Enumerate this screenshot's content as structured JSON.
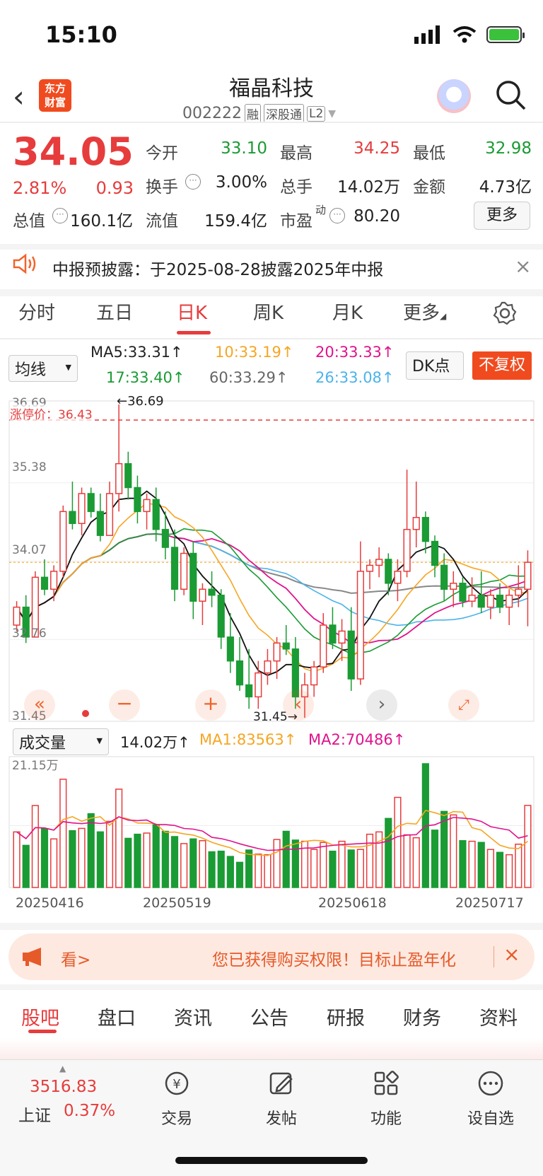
{
  "status": {
    "time": "15:10"
  },
  "header": {
    "back": "‹",
    "logo_line1": "东方",
    "logo_line2": "财富",
    "title": "福晶科技",
    "code": "002222",
    "tags": [
      "融",
      "深股通",
      "L2"
    ]
  },
  "quote": {
    "price": "34.05",
    "change_pct": "2.81%",
    "change_amt": "0.93",
    "open_label": "今开",
    "open": "33.10",
    "high_label": "最高",
    "high": "34.25",
    "low_label": "最低",
    "low": "32.98",
    "turnover_label": "换手",
    "turnover": "3.00%",
    "volume_label": "总手",
    "volume": "14.02万",
    "amount_label": "金额",
    "amount": "4.73亿",
    "mktcap_label": "总值",
    "mktcap": "160.1亿",
    "float_label": "流值",
    "float": "159.4亿",
    "pe_label": "市盈",
    "pe_sup": "动",
    "pe": "80.20",
    "more": "更多"
  },
  "notice": {
    "text": "中报预披露：于2025-08-28披露2025年中报",
    "close": "×"
  },
  "tabs": [
    "分时",
    "五日",
    "日K",
    "周K",
    "月K",
    "更多",
    ""
  ],
  "ma_legend": {
    "select": "均线",
    "ma5": "MA5:33.31↑",
    "ma10": "10:33.19↑",
    "ma20": "20:33.33↑",
    "ma17": "17:33.40↑",
    "ma60": "60:33.29↑",
    "ma26": "26:33.08↑",
    "dk": "DK点",
    "fq": "不复权"
  },
  "chart_labels": {
    "y_top": "36.69",
    "y_2": "35.38",
    "y_3": "34.07",
    "y_4": "32.76",
    "y_bot": "31.45",
    "limit_up": "涨停价：36.43",
    "max_mark": "←36.69",
    "min_mark": "31.45→",
    "vol_select": "成交量",
    "vol_value": "14.02万↑",
    "ma1": "MA1:83563↑",
    "ma2": "MA2:70486↑",
    "vol_max": "21.15万",
    "dates": [
      "20250416",
      "20250519",
      "20250618",
      "20250717"
    ]
  },
  "chart_data": {
    "type": "candlestick",
    "ylim": [
      31.45,
      36.69
    ],
    "limit_up": 36.43,
    "colors": {
      "up": "#e63c3c",
      "down": "#1a9b34"
    },
    "candles": [
      [
        33.0,
        33.4,
        32.9,
        33.3
      ],
      [
        33.3,
        33.5,
        32.7,
        32.8
      ],
      [
        32.8,
        33.9,
        32.8,
        33.8
      ],
      [
        33.8,
        34.1,
        33.5,
        33.6
      ],
      [
        33.6,
        34.0,
        33.4,
        33.9
      ],
      [
        33.9,
        35.0,
        33.8,
        34.9
      ],
      [
        34.9,
        35.4,
        34.6,
        34.7
      ],
      [
        34.7,
        35.3,
        34.5,
        35.2
      ],
      [
        35.2,
        35.3,
        34.8,
        34.9
      ],
      [
        34.9,
        35.2,
        34.4,
        34.5
      ],
      [
        34.5,
        35.4,
        34.5,
        35.2
      ],
      [
        35.2,
        36.69,
        34.9,
        35.7
      ],
      [
        35.7,
        35.9,
        35.1,
        35.3
      ],
      [
        35.3,
        35.5,
        34.7,
        34.9
      ],
      [
        34.9,
        35.2,
        34.6,
        35.1
      ],
      [
        35.1,
        35.3,
        34.4,
        34.6
      ],
      [
        34.6,
        34.9,
        34.1,
        34.3
      ],
      [
        34.3,
        34.6,
        33.4,
        33.6
      ],
      [
        33.6,
        34.3,
        33.5,
        34.2
      ],
      [
        34.2,
        34.4,
        33.1,
        33.4
      ],
      [
        33.4,
        33.7,
        33.0,
        33.6
      ],
      [
        33.6,
        33.9,
        33.3,
        33.5
      ],
      [
        33.5,
        33.6,
        32.6,
        32.8
      ],
      [
        32.8,
        33.2,
        32.2,
        32.4
      ],
      [
        32.4,
        32.8,
        31.9,
        32.0
      ],
      [
        32.0,
        32.6,
        31.6,
        31.8
      ],
      [
        31.8,
        32.4,
        31.6,
        32.2
      ],
      [
        32.2,
        32.6,
        32.0,
        32.4
      ],
      [
        32.4,
        32.8,
        32.1,
        32.7
      ],
      [
        32.7,
        33.0,
        32.5,
        32.6
      ],
      [
        32.6,
        32.8,
        31.6,
        31.8
      ],
      [
        31.8,
        32.2,
        31.45,
        32.0
      ],
      [
        32.0,
        32.4,
        31.8,
        32.3
      ],
      [
        32.3,
        33.2,
        32.2,
        33.0
      ],
      [
        33.0,
        33.3,
        32.6,
        32.7
      ],
      [
        32.7,
        33.1,
        32.4,
        32.9
      ],
      [
        32.9,
        33.3,
        31.9,
        32.1
      ],
      [
        32.1,
        34.4,
        32.0,
        33.9
      ],
      [
        33.9,
        34.1,
        33.6,
        34.0
      ],
      [
        34.0,
        34.3,
        33.8,
        34.1
      ],
      [
        34.1,
        34.2,
        33.5,
        33.7
      ],
      [
        33.7,
        34.1,
        33.4,
        33.9
      ],
      [
        33.9,
        35.6,
        33.8,
        34.6
      ],
      [
        34.6,
        35.4,
        34.3,
        34.8
      ],
      [
        34.8,
        34.9,
        34.2,
        34.4
      ],
      [
        34.4,
        34.5,
        33.8,
        34.0
      ],
      [
        34.0,
        34.2,
        33.4,
        33.6
      ],
      [
        33.6,
        33.9,
        33.3,
        33.7
      ],
      [
        33.7,
        33.8,
        33.3,
        33.4
      ],
      [
        33.4,
        33.8,
        33.3,
        33.5
      ],
      [
        33.5,
        33.9,
        33.2,
        33.3
      ],
      [
        33.3,
        33.6,
        33.1,
        33.5
      ],
      [
        33.5,
        33.7,
        33.2,
        33.3
      ],
      [
        33.3,
        33.6,
        33.0,
        33.5
      ],
      [
        33.5,
        34.0,
        33.3,
        33.6
      ],
      [
        33.6,
        34.25,
        32.98,
        34.05
      ]
    ],
    "volume": [
      9.5,
      7.2,
      14,
      10,
      8.3,
      18.5,
      9.7,
      10.1,
      12.6,
      9.5,
      11.3,
      16.8,
      8.4,
      9.1,
      9.3,
      10.7,
      9.6,
      8.7,
      7.5,
      8.3,
      8.0,
      6.1,
      6.2,
      5.3,
      4.3,
      6.4,
      5.7,
      5.6,
      8.2,
      9.6,
      8.1,
      7.9,
      6.5,
      7.7,
      6.2,
      7.9,
      6.4,
      6.5,
      9.1,
      9.5,
      11.8,
      15.4,
      9.0,
      8.5,
      21.15,
      9.8,
      13.0,
      12.4,
      8.0,
      7.9,
      7.7,
      6.5,
      6.0,
      5.6,
      7.4,
      14.02
    ]
  },
  "banner": {
    "look": "看>",
    "text": "您已获得购买权限！目标止盈年化",
    "close": "×"
  },
  "bottom_tabs": [
    "股吧",
    "盘口",
    "资讯",
    "公告",
    "研报",
    "财务",
    "资料"
  ],
  "bottom_nav": {
    "index_value": "3516.83",
    "index_name": "上证",
    "index_pct": "0.37%",
    "trade": "交易",
    "post": "发帖",
    "func": "功能",
    "watch": "设自选"
  }
}
